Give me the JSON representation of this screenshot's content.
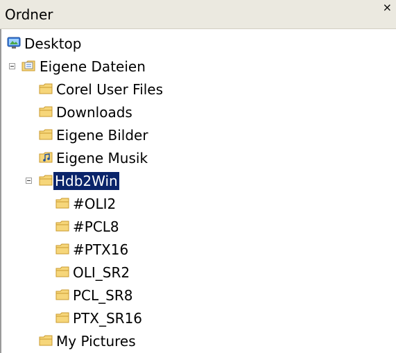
{
  "panel": {
    "title": "Ordner",
    "close_glyph": "×"
  },
  "tree": {
    "items": [
      {
        "label": "Desktop",
        "icon": "desktop-icon",
        "level": 0
      },
      {
        "label": "Eigene Dateien",
        "icon": "my-documents-icon",
        "level": 1,
        "expanded": true
      },
      {
        "label": "Corel User Files",
        "icon": "folder-icon",
        "level": 2
      },
      {
        "label": "Downloads",
        "icon": "folder-icon",
        "level": 2
      },
      {
        "label": "Eigene Bilder",
        "icon": "folder-icon",
        "level": 2
      },
      {
        "label": "Eigene Musik",
        "icon": "music-folder-icon",
        "level": 2
      },
      {
        "label": "Hdb2Win",
        "icon": "folder-icon",
        "level": 2,
        "expanded": true,
        "selected": true
      },
      {
        "label": "#OLI2",
        "icon": "folder-icon",
        "level": 3
      },
      {
        "label": "#PCL8",
        "icon": "folder-icon",
        "level": 3
      },
      {
        "label": "#PTX16",
        "icon": "folder-icon",
        "level": 3
      },
      {
        "label": "OLI_SR2",
        "icon": "folder-icon",
        "level": 3
      },
      {
        "label": "PCL_SR8",
        "icon": "folder-icon",
        "level": 3
      },
      {
        "label": "PTX_SR16",
        "icon": "folder-icon",
        "level": 3
      },
      {
        "label": "My Pictures",
        "icon": "folder-icon",
        "level": 2
      }
    ]
  },
  "colors": {
    "header_bg": "#ebe9e0",
    "selection_bg": "#0a246a",
    "selection_fg": "#ffffff",
    "folder_fill": "#f6d67a",
    "folder_stroke": "#c99a2e"
  }
}
